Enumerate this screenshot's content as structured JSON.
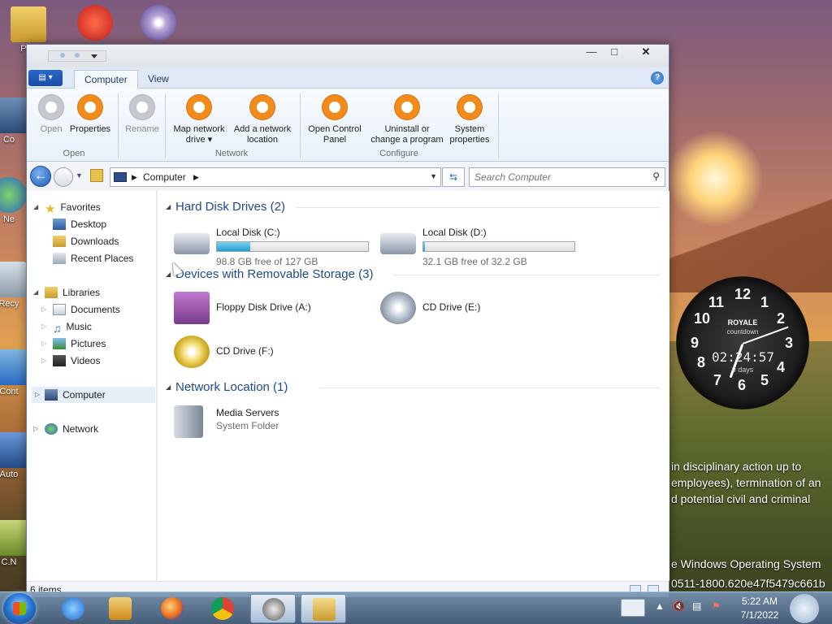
{
  "desktop": {
    "icons": [
      {
        "label": "Pha"
      },
      {
        "label": "Co"
      },
      {
        "label": "Ne"
      },
      {
        "label": "Recy"
      },
      {
        "label": "Cont"
      },
      {
        "label": "Auto"
      },
      {
        "label": "C.N"
      }
    ],
    "wallpaper_text": [
      "in disciplinary action up to",
      "employees), termination of an",
      "d potential civil and criminal"
    ],
    "watermark_line1": "e Windows Operating System",
    "watermark_line2": "0511-1800.620e47f5479c661b",
    "clock_gadget": {
      "brand": "ROYALE",
      "subtitle": "countdown",
      "time": "02:24:57",
      "days": "0 days",
      "numerals": [
        "12",
        "1",
        "2",
        "3",
        "4",
        "5",
        "6",
        "7",
        "8",
        "9",
        "10",
        "11"
      ]
    }
  },
  "window": {
    "tabs": [
      {
        "label": "Computer",
        "active": true
      },
      {
        "label": "View",
        "active": false
      }
    ],
    "ribbon": {
      "groups": [
        {
          "label": "Open",
          "buttons": [
            {
              "label": "Open",
              "enabled": false
            },
            {
              "label": "Properties",
              "enabled": true
            }
          ]
        },
        {
          "label": "",
          "buttons": [
            {
              "label": "Rename",
              "enabled": false
            }
          ]
        },
        {
          "label": "Network",
          "buttons": [
            {
              "label_line1": "Map network",
              "label_line2": "drive ▾",
              "enabled": true
            },
            {
              "label_line1": "Add a network",
              "label_line2": "location",
              "enabled": true
            }
          ]
        },
        {
          "label": "Configure",
          "buttons": [
            {
              "label_line1": "Open Control",
              "label_line2": "Panel",
              "enabled": true
            },
            {
              "label_line1": "Uninstall or",
              "label_line2": "change a program",
              "enabled": true
            },
            {
              "label_line1": "System",
              "label_line2": "properties",
              "enabled": true
            }
          ]
        }
      ]
    },
    "address": {
      "crumb": "Computer"
    },
    "search": {
      "placeholder": "Search Computer"
    },
    "nav": {
      "favorites": {
        "label": "Favorites",
        "items": [
          "Desktop",
          "Downloads",
          "Recent Places"
        ]
      },
      "libraries": {
        "label": "Libraries",
        "items": [
          "Documents",
          "Music",
          "Pictures",
          "Videos"
        ]
      },
      "computer": "Computer",
      "network": "Network"
    },
    "groups": {
      "hdd": {
        "title": "Hard Disk Drives (2)",
        "items": [
          {
            "name": "Local Disk (C:)",
            "detail": "98.8 GB free of 127 GB",
            "used_fraction": 0.22
          },
          {
            "name": "Local Disk (D:)",
            "detail": "32.1 GB free of 32.2 GB",
            "used_fraction": 0.003
          }
        ]
      },
      "removable": {
        "title": "Devices with Removable Storage (3)",
        "items": [
          {
            "name": "Floppy Disk Drive (A:)"
          },
          {
            "name": "CD Drive (E:)"
          },
          {
            "name": "CD Drive (F:)"
          }
        ]
      },
      "network": {
        "title": "Network Location (1)",
        "items": [
          {
            "name": "Media Servers",
            "detail": "System Folder"
          }
        ]
      }
    },
    "status": {
      "items": "6 items"
    }
  },
  "taskbar": {
    "time": "5:22 AM",
    "date": "7/1/2022",
    "pinned": [
      "internet-explorer-icon",
      "media-center-icon",
      "firefox-icon",
      "chrome-icon",
      "raccoon-app-icon",
      "windows-explorer-icon"
    ]
  },
  "colors": {
    "accent": "#f08b1c",
    "link": "#1e4a8c",
    "bar_fill": "#1f9ed2"
  }
}
